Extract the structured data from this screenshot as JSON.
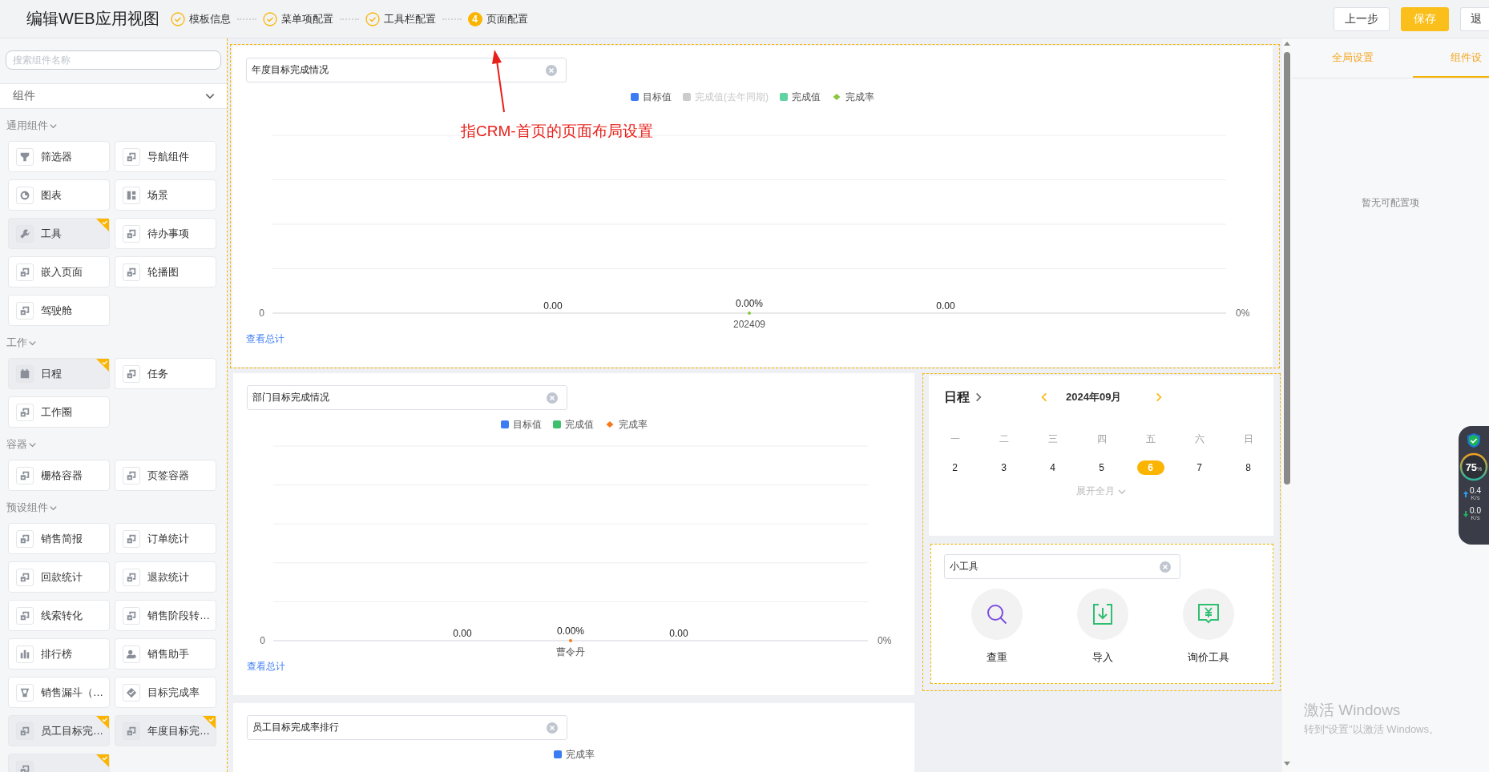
{
  "header": {
    "title": "编辑WEB应用视图",
    "steps": [
      {
        "label": "模板信息",
        "done": true
      },
      {
        "label": "菜单项配置",
        "done": true
      },
      {
        "label": "工具栏配置",
        "done": true
      },
      {
        "label": "页面配置",
        "done": false,
        "number": "4"
      }
    ],
    "buttons": [
      {
        "label": "上一步",
        "kind": "default"
      },
      {
        "label": "保存",
        "kind": "primary"
      },
      {
        "label": "退",
        "kind": "default"
      }
    ]
  },
  "annotation": {
    "text": "指CRM-首页的页面布局设置"
  },
  "sidebar": {
    "search": {
      "placeholder": "搜索组件名称"
    },
    "category": {
      "label": "组件"
    },
    "groups": [
      {
        "label": "通用组件",
        "expanded": true,
        "items": [
          {
            "label": "筛选器",
            "kind": "funnel",
            "added": false
          },
          {
            "label": "导航组件",
            "kind": "squares",
            "added": false
          },
          {
            "label": "图表",
            "kind": "pie",
            "added": false
          },
          {
            "label": "场景",
            "kind": "layout",
            "added": false
          },
          {
            "label": "工具",
            "kind": "wrench",
            "added": true
          },
          {
            "label": "待办事项",
            "kind": "squares",
            "added": false
          },
          {
            "label": "嵌入页面",
            "kind": "squares",
            "added": false
          },
          {
            "label": "轮播图",
            "kind": "squares",
            "added": false
          },
          {
            "label": "驾驶舱",
            "kind": "squares",
            "added": false
          }
        ]
      },
      {
        "label": "工作",
        "expanded": true,
        "items": [
          {
            "label": "日程",
            "kind": "calendar",
            "added": true
          },
          {
            "label": "任务",
            "kind": "squares",
            "added": false
          },
          {
            "label": "工作圈",
            "kind": "squares",
            "added": false
          }
        ]
      },
      {
        "label": "容器",
        "expanded": true,
        "items": [
          {
            "label": "栅格容器",
            "kind": "squares",
            "added": false
          },
          {
            "label": "页签容器",
            "kind": "squares",
            "added": false
          }
        ]
      },
      {
        "label": "预设组件",
        "expanded": true,
        "items": [
          {
            "label": "销售简报",
            "kind": "squares",
            "added": false
          },
          {
            "label": "订单统计",
            "kind": "squares",
            "added": false
          },
          {
            "label": "回款统计",
            "kind": "squares",
            "added": false
          },
          {
            "label": "退款统计",
            "kind": "squares",
            "added": false
          },
          {
            "label": "线索转化",
            "kind": "squares",
            "added": false
          },
          {
            "label": "销售阶段转…",
            "kind": "squares",
            "added": false
          },
          {
            "label": "排行榜",
            "kind": "bars",
            "added": false
          },
          {
            "label": "销售助手",
            "kind": "person",
            "added": false
          },
          {
            "label": "销售漏斗（…",
            "kind": "cup",
            "added": false
          },
          {
            "label": "目标完成率",
            "kind": "diamond",
            "added": false
          },
          {
            "label": "员工目标完…",
            "kind": "squares",
            "added": true
          },
          {
            "label": "年度目标完…",
            "kind": "squares",
            "added": true
          },
          {
            "kind": "squares",
            "added": true
          }
        ]
      }
    ]
  },
  "canvas": {
    "charts": [
      {
        "title_field": "年度目标完成情况",
        "link": "查看总计",
        "left_tick": "0",
        "right_tick": "0%",
        "value_labels": [
          "0.00",
          "0.00%",
          "0.00"
        ],
        "category": "202409",
        "legend": [
          {
            "name": "目标值",
            "color": "#3b7cf5",
            "kind": "bar",
            "enabled": true
          },
          {
            "name": "完成值(去年同期)",
            "color": "#cccccc",
            "kind": "bar",
            "enabled": false
          },
          {
            "name": "完成值",
            "color": "#5fd3a1",
            "kind": "bar",
            "enabled": true
          },
          {
            "name": "完成率",
            "color": "#8cc63f",
            "kind": "line",
            "enabled": true
          }
        ]
      },
      {
        "title_field": "部门目标完成情况",
        "link": "查看总计",
        "left_tick": "0",
        "right_tick": "0%",
        "value_labels": [
          "0.00",
          "0.00%",
          "0.00"
        ],
        "category": "曹令丹",
        "legend": [
          {
            "name": "目标值",
            "color": "#3b7cf5",
            "kind": "bar",
            "enabled": true
          },
          {
            "name": "完成值",
            "color": "#3cc06b",
            "kind": "bar",
            "enabled": true
          },
          {
            "name": "完成率",
            "color": "#f57a1c",
            "kind": "line",
            "enabled": true
          }
        ]
      },
      {
        "title_field": "员工目标完成率排行",
        "legend": [
          {
            "name": "完成率",
            "color": "#3b7cf5",
            "kind": "bar",
            "enabled": true
          }
        ]
      }
    ],
    "calendar": {
      "title": "日程",
      "month": "2024年09月",
      "weekdays": [
        "一",
        "二",
        "三",
        "四",
        "五",
        "六",
        "日"
      ],
      "days": [
        {
          "label": "2",
          "selected": false
        },
        {
          "label": "3",
          "selected": false
        },
        {
          "label": "4",
          "selected": false
        },
        {
          "label": "5",
          "selected": false
        },
        {
          "label": "6",
          "selected": true
        },
        {
          "label": "7",
          "selected": false
        },
        {
          "label": "8",
          "selected": false
        }
      ],
      "expand_link": "展开全月"
    },
    "tools": {
      "title_field": "小工具",
      "items": [
        {
          "label": "查重",
          "kind": "search"
        },
        {
          "label": "导入",
          "kind": "import"
        },
        {
          "label": "询价工具",
          "kind": "price"
        }
      ]
    }
  },
  "settings_panel": {
    "tabs": [
      {
        "label": "全局设置",
        "selected": false
      },
      {
        "label": "组件设",
        "selected": true
      }
    ],
    "empty_text": "暂无可配置项"
  },
  "monitor_widget": {
    "usage": "75",
    "usage_unit": "%",
    "upload": "0.4",
    "upload_unit": "K/s",
    "download": "0.0",
    "download_unit": "K/s"
  },
  "activation_notice": {
    "title": "激活 Windows",
    "subtitle": "转到“设置”以激活 Windows。"
  }
}
